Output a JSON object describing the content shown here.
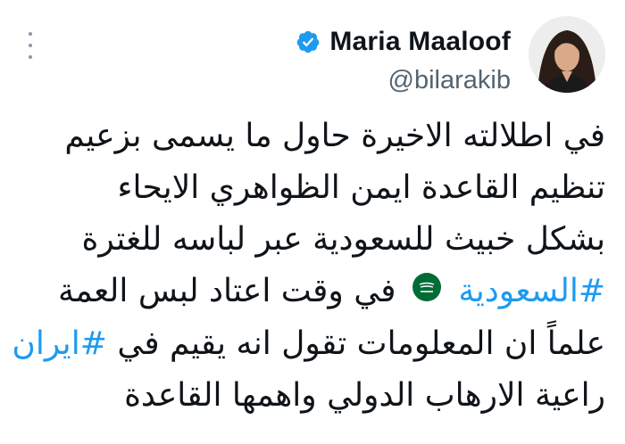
{
  "author": {
    "display_name": "Maria Maaloof",
    "handle": "@bilarakib",
    "verified": true
  },
  "tweet": {
    "line1": "في اطلالته الاخيرة حاول ما يسمى بزعيم",
    "line2": "تنظيم القاعدة ايمن الظواهري الايحاء",
    "line3": "بشكل خبيث للسعودية عبر لباسه للغترة",
    "line4_hashtag": "#السعودية",
    "line4_text": "في وقت اعتاد لبس العمة",
    "line5_text": "علماً ان المعلومات تقول انه يقيم في",
    "line5_hashtag": "#ايران",
    "line6": "راعية الارهاب الدولي واهمها القاعدة"
  },
  "colors": {
    "link": "#1d9bf0",
    "verified": "#1d9bf0",
    "secondary_text": "#536471",
    "flag_green": "#006c35"
  },
  "icons": {
    "more": "more-dots-icon",
    "verified": "verified-badge-icon",
    "flag": "saudi-flag-emoji"
  }
}
